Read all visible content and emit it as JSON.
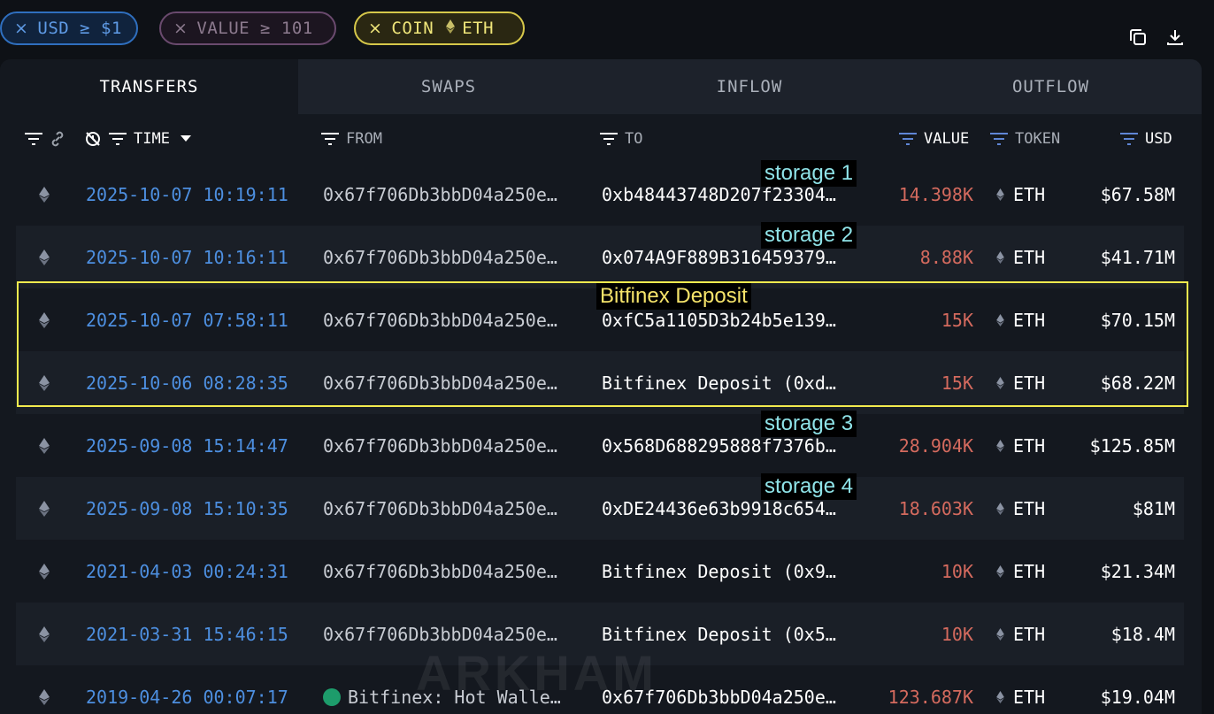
{
  "filters": [
    {
      "prefix": "×",
      "label": "USD ≥ $1"
    },
    {
      "prefix": "×",
      "label": "VALUE ≥ 101"
    },
    {
      "prefix": "×",
      "label": "COIN",
      "coin": "ETH"
    }
  ],
  "toolbar_icons": [
    "copy-icon",
    "download-icon"
  ],
  "tabs": [
    "TRANSFERS",
    "SWAPS",
    "INFLOW",
    "OUTFLOW"
  ],
  "active_tab": "TRANSFERS",
  "columns": {
    "time": "TIME",
    "from": "FROM",
    "to": "TO",
    "value": "VALUE",
    "token": "TOKEN",
    "usd": "USD"
  },
  "rows": [
    {
      "time": "2025-10-07 10:19:11",
      "from": "0x67f706Db3bbD04a250e…",
      "to": "0xb48443748D207f23304…",
      "value": "14.398K",
      "token": "ETH",
      "usd": "$67.58M"
    },
    {
      "time": "2025-10-07 10:16:11",
      "from": "0x67f706Db3bbD04a250e…",
      "to": "0x074A9F889B316459379…",
      "value": "8.88K",
      "token": "ETH",
      "usd": "$41.71M"
    },
    {
      "time": "2025-10-07 07:58:11",
      "from": "0x67f706Db3bbD04a250e…",
      "to": "0xfC5a1105D3b24b5e139…",
      "value": "15K",
      "token": "ETH",
      "usd": "$70.15M"
    },
    {
      "time": "2025-10-06 08:28:35",
      "from": "0x67f706Db3bbD04a250e…",
      "to": "Bitfinex Deposit (0xd…",
      "value": "15K",
      "token": "ETH",
      "usd": "$68.22M"
    },
    {
      "time": "2025-09-08 15:14:47",
      "from": "0x67f706Db3bbD04a250e…",
      "to": "0x568D688295888f7376b…",
      "value": "28.904K",
      "token": "ETH",
      "usd": "$125.85M"
    },
    {
      "time": "2025-09-08 15:10:35",
      "from": "0x67f706Db3bbD04a250e…",
      "to": "0xDE24436e63b9918c654…",
      "value": "18.603K",
      "token": "ETH",
      "usd": "$81M"
    },
    {
      "time": "2021-04-03 00:24:31",
      "from": "0x67f706Db3bbD04a250e…",
      "to": "Bitfinex Deposit (0x9…",
      "value": "10K",
      "token": "ETH",
      "usd": "$21.34M"
    },
    {
      "time": "2021-03-31 15:46:15",
      "from": "0x67f706Db3bbD04a250e…",
      "to": "Bitfinex Deposit (0x5…",
      "value": "10K",
      "token": "ETH",
      "usd": "$18.4M"
    },
    {
      "time": "2019-04-26 00:07:17",
      "from": "Bitfinex: Hot Walle…",
      "to": "0x67f706Db3bbD04a250e…",
      "value": "123.687K",
      "token": "ETH",
      "usd": "$19.04M"
    }
  ],
  "annotations": {
    "storage1": "storage 1",
    "storage2": "storage 2",
    "bitfinex": "Bitfinex Deposit",
    "storage3": "storage 3",
    "storage4": "storage 4"
  },
  "watermark": "ARKHAM"
}
